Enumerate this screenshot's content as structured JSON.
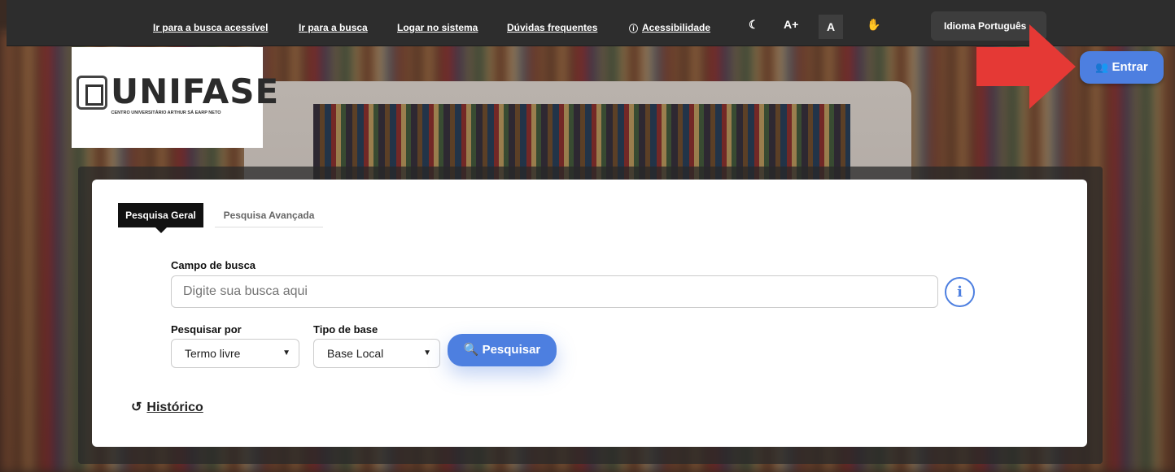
{
  "topbar": {
    "links": [
      "Ir para a busca acessível",
      "Ir para a busca",
      "Logar no sistema",
      "Dúvidas frequentes",
      "Acessibilidade"
    ],
    "font_increase": "A+",
    "font_reset": "A",
    "language": "Idioma Português"
  },
  "logo": {
    "name": "UNIFASE",
    "subtitle": "CENTRO UNIVERSITÁRIO ARTHUR SÁ EARP NETO"
  },
  "header": {
    "login_button": "Entrar"
  },
  "search": {
    "tabs": [
      "Pesquisa Geral",
      "Pesquisa Avançada"
    ],
    "field_label": "Campo de busca",
    "placeholder": "Digite sua busca aqui",
    "search_by_label": "Pesquisar por",
    "search_by_value": "Termo livre",
    "base_label": "Tipo de base",
    "base_value": "Base Local",
    "submit": "Pesquisar",
    "history": "Histórico"
  },
  "colors": {
    "accent": "#4d7fe0",
    "arrow": "#e53935",
    "topbar": "#2d2d2d"
  }
}
